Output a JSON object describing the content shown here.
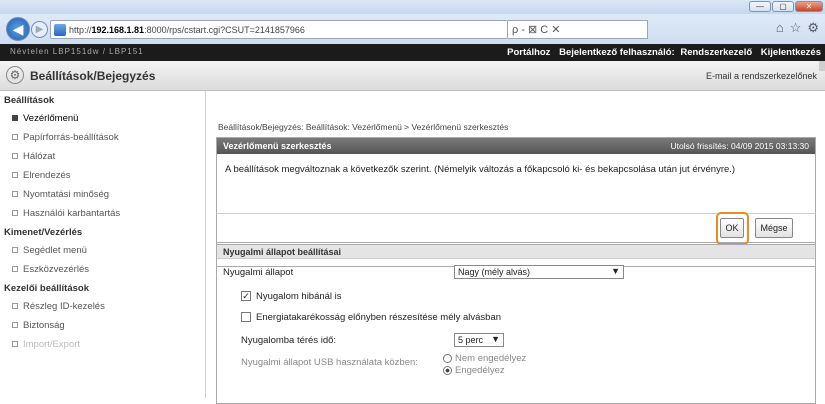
{
  "browser": {
    "url_prefix": "http://",
    "url_host": "192.168.1.81",
    "url_rest": ":8000/rps/cstart.cgi?CSUT=2141857966",
    "url_tools": "ρ - ⊠ C ✕",
    "window_buttons": [
      "—",
      "▢",
      "✕"
    ],
    "toolbar_icons": [
      "home-icon",
      "star-icon",
      "gear-icon"
    ]
  },
  "topbar": {
    "device_name": "Névtelen   LBP151dw / LBP151",
    "portal_link": "Portálhoz",
    "login_user_label": "Bejelentkező felhasználó:",
    "login_user": "Rendszerkezelő",
    "logout": "Kijelentkezés"
  },
  "header": {
    "title": "Beállítások/Bejegyzés",
    "mail_link": "E-mail a rendszerkezelőnek"
  },
  "sidebar": {
    "sections": [
      {
        "heading": "Beállítások",
        "items": [
          {
            "label": "Vezérlőmenü",
            "selected": true
          },
          {
            "label": "Papírforrás-beállítások"
          },
          {
            "label": "Hálózat"
          },
          {
            "label": "Elrendezés"
          },
          {
            "label": "Nyomtatási minőség"
          },
          {
            "label": "Használói karbantartás"
          }
        ]
      },
      {
        "heading": "Kimenet/Vezérlés",
        "items": [
          {
            "label": "Segédlet menü"
          },
          {
            "label": "Eszközvezérlés"
          }
        ]
      },
      {
        "heading": "Kezelői beállítások",
        "items": [
          {
            "label": "Részleg ID-kezelés"
          },
          {
            "label": "Biztonság"
          },
          {
            "label": "Import/Export"
          }
        ]
      }
    ]
  },
  "main": {
    "breadcrumb": "Beállítások/Bejegyzés: Beállítások: Vezérlőmenü > Vezérlőmenü szerkesztés",
    "edit_panel": {
      "title": "Vezérlőmenü szerkesztés",
      "last_updated": "Utolsó frissítés: 04/09 2015 03:13:30",
      "message": "A beállítások megváltoznak a következők szerint. (Némelyik változás a főkapcsoló ki- és bekapcsolása után jut érvényre.)",
      "ok_label": "OK",
      "cancel_label": "Mégse"
    },
    "sleep_panel": {
      "title": "Nyugalmi állapot beállításai",
      "mode_label": "Nyugalmi állapot",
      "mode_value": "Nagy (mély alvás)",
      "check_error": "Nyugalom hibánál is",
      "check_error_checked": true,
      "check_energy": "Energiatakarékosság előnyben részesítése mély alvásban",
      "check_energy_checked": false,
      "time_label": "Nyugalomba térés idő:",
      "time_value": "5 perc",
      "usb_label": "Nyugalmi állapot USB használata közben:",
      "usb_options": [
        "Nem engedélyez",
        "Engedélyez"
      ],
      "usb_selected": "Engedélyez"
    }
  },
  "colors": {
    "highlight": "#f08a1a",
    "panel_header": "#666666",
    "topbar": "#1b1b1b"
  }
}
